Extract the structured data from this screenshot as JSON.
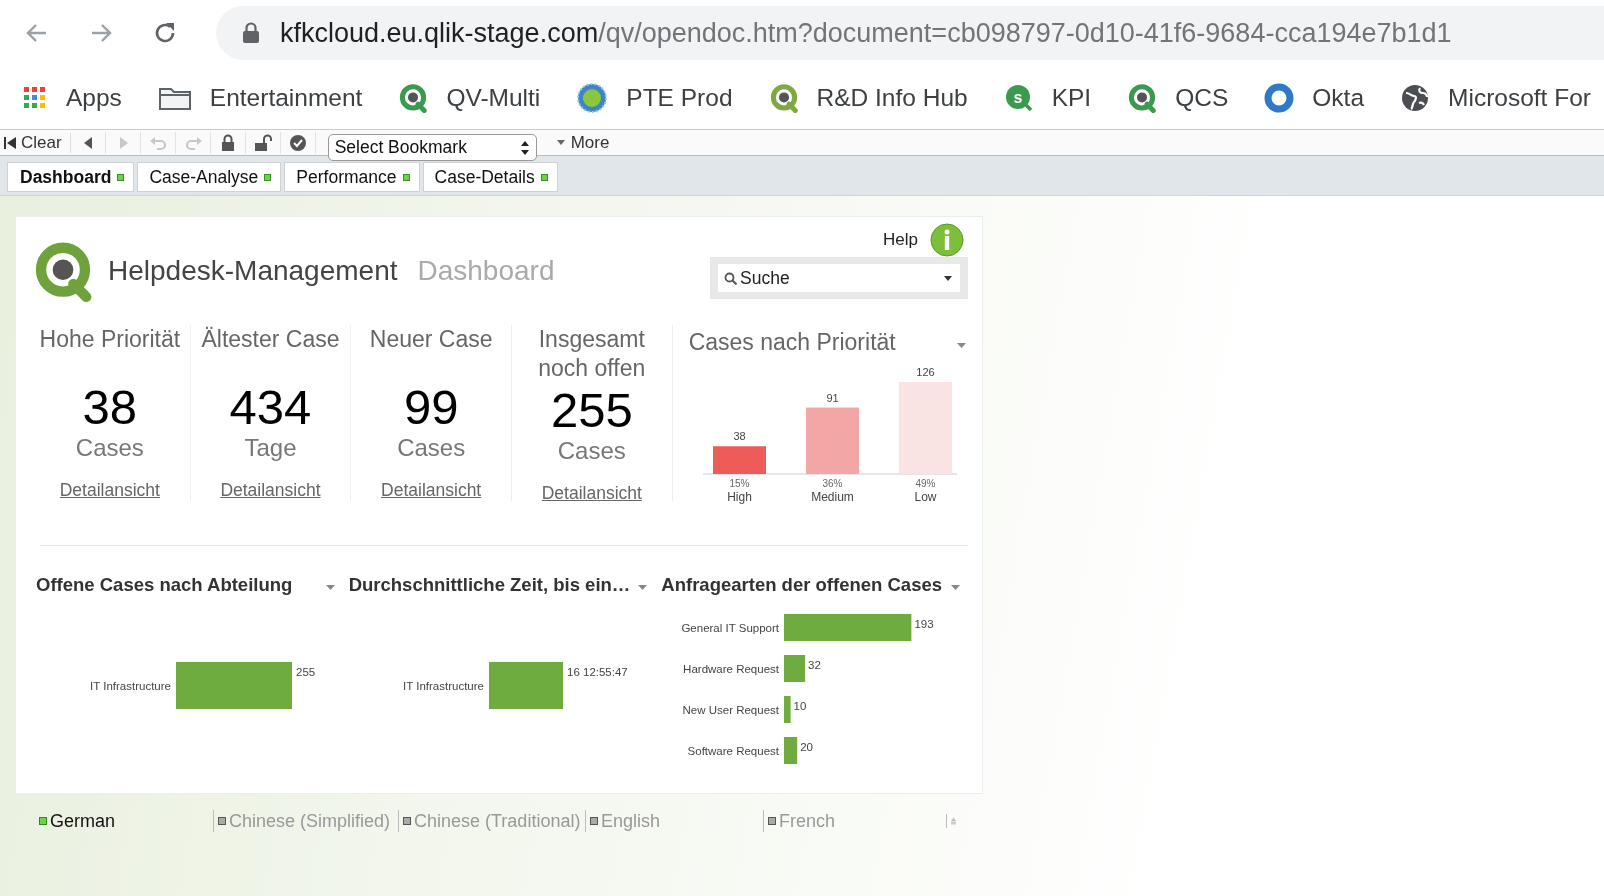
{
  "browser": {
    "url_host": "kfkcloud.eu.qlik-stage.com",
    "url_path": "/qv/opendoc.htm?document=cb098797-0d10-41f6-9684-cca194e7b1d1"
  },
  "bookmarks": [
    {
      "label": "Apps",
      "kind": "apps"
    },
    {
      "label": "Entertainment",
      "kind": "folder"
    },
    {
      "label": "QV-Multi",
      "kind": "qlik"
    },
    {
      "label": "PTE Prod",
      "kind": "globe"
    },
    {
      "label": "R&D Info Hub",
      "kind": "qlik-olive"
    },
    {
      "label": "KPI",
      "kind": "s"
    },
    {
      "label": "QCS",
      "kind": "qlik"
    },
    {
      "label": "Okta",
      "kind": "okta"
    },
    {
      "label": "Microsoft For",
      "kind": "world"
    }
  ],
  "toolbar": {
    "clear": "Clear",
    "tools": [
      {
        "kind": "back",
        "disabled": false
      },
      {
        "kind": "forward",
        "disabled": true
      },
      {
        "kind": "undo",
        "disabled": true
      },
      {
        "kind": "redo",
        "disabled": true
      },
      {
        "kind": "lock",
        "disabled": false
      },
      {
        "kind": "unlock",
        "disabled": false
      },
      {
        "kind": "check",
        "disabled": false
      }
    ],
    "bookmark_select": "Select Bookmark",
    "more": "More"
  },
  "tabs": [
    {
      "label": "Dashboard",
      "selected": true
    },
    {
      "label": "Case-Analyse",
      "selected": false
    },
    {
      "label": "Performance",
      "selected": false
    },
    {
      "label": "Case-Details",
      "selected": false
    }
  ],
  "header": {
    "title": "Helpdesk-Management",
    "subtitle": "Dashboard",
    "help": "Help",
    "search": {
      "placeholder": "Suche"
    }
  },
  "kpis": [
    {
      "title": "Hohe Priorität",
      "value": "38",
      "unit": "Cases",
      "link": "Detailansicht"
    },
    {
      "title": "Ältester Case",
      "value": "434",
      "unit": "Tage",
      "link": "Detailansicht"
    },
    {
      "title": "Neuer Case",
      "value": "99",
      "unit": "Cases",
      "link": "Detailansicht"
    },
    {
      "title": "Insgesamt noch offen",
      "value": "255",
      "unit": "Cases",
      "link": "Detailansicht"
    }
  ],
  "priority_chart": {
    "chart_data": {
      "type": "bar",
      "orientation": "vertical",
      "title": "Cases nach Priorität",
      "categories": [
        "High",
        "Medium",
        "Low"
      ],
      "values": [
        38,
        91,
        126
      ],
      "data_labels": true,
      "annotations": [
        "15%",
        "36%",
        "49%"
      ]
    }
  },
  "bottom_charts": [
    {
      "title": "Offene Cases nach Abteilung",
      "bar": {
        "category": "IT Infrastructure",
        "label": "255"
      }
    },
    {
      "title": "Durchschnittliche Zeit, bis ein…",
      "bar": {
        "category": "IT Infrastructure",
        "label": "16 12:55:47"
      }
    },
    {
      "chart_data": {
        "type": "bar",
        "orientation": "horizontal",
        "title": "Anfragearten der offenen Cases",
        "categories": [
          "General IT Support",
          "Hardware Request",
          "New User Request",
          "Software Request"
        ],
        "values": [
          193,
          32,
          10,
          20
        ],
        "data_labels": true
      }
    }
  ],
  "languages": [
    {
      "label": "German",
      "selected": true
    },
    {
      "label": "Chinese (Simplified)",
      "selected": false
    },
    {
      "label": "Chinese (Traditional)",
      "selected": false
    },
    {
      "label": "English",
      "selected": false
    },
    {
      "label": "French",
      "selected": false
    }
  ]
}
